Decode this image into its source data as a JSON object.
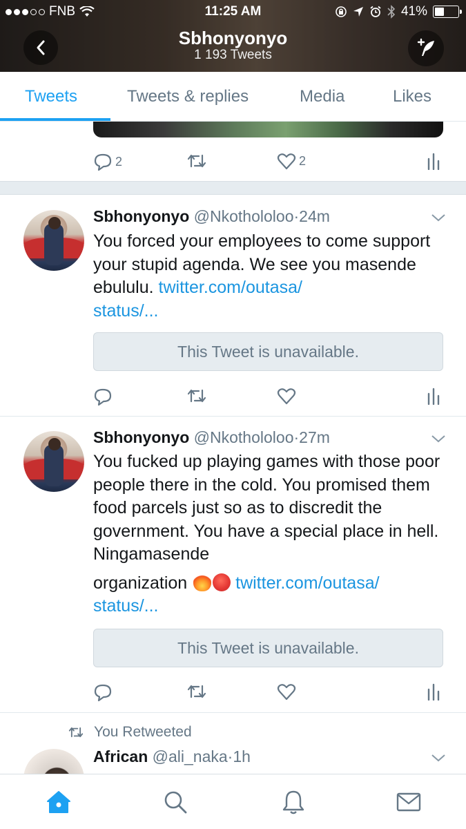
{
  "status_bar": {
    "carrier": "FNB",
    "time": "11:25 AM",
    "battery": "41%",
    "battery_level": 0.41
  },
  "header": {
    "title": "Sbhonyonyo",
    "subtitle": "1 193 Tweets",
    "back_icon": "chevron-left-icon",
    "compose_icon": "quill-icon"
  },
  "tabs": [
    {
      "label": "Tweets",
      "active": true
    },
    {
      "label": "Tweets & replies",
      "active": false
    },
    {
      "label": "Media",
      "active": false
    },
    {
      "label": "Likes",
      "active": false
    }
  ],
  "tweets": [
    {
      "reply_count": "2",
      "like_count": "2"
    },
    {
      "name": "Sbhonyonyo",
      "handle": "@Nkothololoo",
      "time": "24m",
      "text": "You forced your employees to come support your stupid agenda. We see you masende ebululu.",
      "link_a": "twitter.com/outasa/",
      "link_b": "status/...",
      "quote": "This Tweet is unavailable."
    },
    {
      "name": "Sbhonyonyo",
      "handle": "@Nkothololoo",
      "time": "27m",
      "text": "You fucked up playing games with those poor people there in the cold. You promised them food parcels just so as to discredit the government. You have a special place in hell. Ningamasende",
      "text_b": "organization",
      "link_a": "twitter.com/outasa/",
      "link_b": "status/...",
      "quote": "This Tweet is unavailable."
    },
    {
      "retweet_label": "You Retweeted",
      "name": "African",
      "handle": "@ali_naka",
      "time": "1h"
    }
  ],
  "separator": "·",
  "colors": {
    "accent": "#1da1f2",
    "link": "#1b95e0",
    "muted": "#657786",
    "text": "#14171a"
  }
}
